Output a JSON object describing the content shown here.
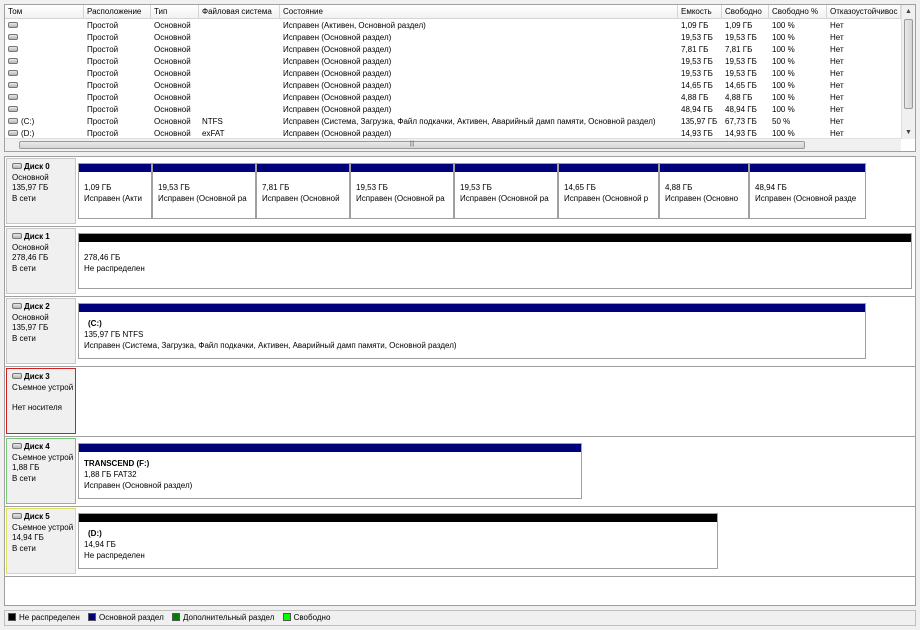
{
  "volume_list": {
    "columns": [
      "Том",
      "Расположение",
      "Тип",
      "Файловая система",
      "Состояние",
      "Емкость",
      "Свободно",
      "Свободно %",
      "Отказоустойчивос"
    ],
    "rows": [
      [
        "",
        "Простой",
        "Основной",
        "",
        "Исправен (Активен, Основной раздел)",
        "1,09 ГБ",
        "1,09 ГБ",
        "100 %",
        "Нет"
      ],
      [
        "",
        "Простой",
        "Основной",
        "",
        "Исправен (Основной раздел)",
        "19,53 ГБ",
        "19,53 ГБ",
        "100 %",
        "Нет"
      ],
      [
        "",
        "Простой",
        "Основной",
        "",
        "Исправен (Основной раздел)",
        "7,81 ГБ",
        "7,81 ГБ",
        "100 %",
        "Нет"
      ],
      [
        "",
        "Простой",
        "Основной",
        "",
        "Исправен (Основной раздел)",
        "19,53 ГБ",
        "19,53 ГБ",
        "100 %",
        "Нет"
      ],
      [
        "",
        "Простой",
        "Основной",
        "",
        "Исправен (Основной раздел)",
        "19,53 ГБ",
        "19,53 ГБ",
        "100 %",
        "Нет"
      ],
      [
        "",
        "Простой",
        "Основной",
        "",
        "Исправен (Основной раздел)",
        "14,65 ГБ",
        "14,65 ГБ",
        "100 %",
        "Нет"
      ],
      [
        "",
        "Простой",
        "Основной",
        "",
        "Исправен (Основной раздел)",
        "4,88 ГБ",
        "4,88 ГБ",
        "100 %",
        "Нет"
      ],
      [
        "",
        "Простой",
        "Основной",
        "",
        "Исправен (Основной раздел)",
        "48,94 ГБ",
        "48,94 ГБ",
        "100 %",
        "Нет"
      ],
      [
        "(C:)",
        "Простой",
        "Основной",
        "NTFS",
        "Исправен (Система, Загрузка, Файл подкачки, Активен, Аварийный дамп памяти, Основной раздел)",
        "135,97 ГБ",
        "67,73 ГБ",
        "50 %",
        "Нет"
      ],
      [
        "(D:)",
        "Простой",
        "Основной",
        "exFAT",
        "Исправен (Основной раздел)",
        "14,93 ГБ",
        "14,93 ГБ",
        "100 %",
        "Нет"
      ]
    ]
  },
  "disks": [
    {
      "name": "Диск 0",
      "type": "Основной",
      "size": "135,97 ГБ",
      "status": "В сети",
      "partitions": [
        {
          "size": "1,09 ГБ",
          "state": "Исправен (Акти"
        },
        {
          "size": "19,53 ГБ",
          "state": "Исправен (Основной ра"
        },
        {
          "size": "7,81 ГБ",
          "state": "Исправен (Основной"
        },
        {
          "size": "19,53 ГБ",
          "state": "Исправен (Основной ра"
        },
        {
          "size": "19,53 ГБ",
          "state": "Исправен (Основной ра"
        },
        {
          "size": "14,65 ГБ",
          "state": "Исправен (Основной р"
        },
        {
          "size": "4,88 ГБ",
          "state": "Исправен (Основно"
        },
        {
          "size": "48,94 ГБ",
          "state": "Исправен (Основной разде"
        }
      ]
    },
    {
      "name": "Диск 1",
      "type": "Основной",
      "size": "278,46 ГБ",
      "status": "В сети",
      "partitions": [
        {
          "size": "278,46 ГБ",
          "state": "Не распределен"
        }
      ]
    },
    {
      "name": "Диск 2",
      "type": "Основной",
      "size": "135,97 ГБ",
      "status": "В сети",
      "partitions": [
        {
          "label": "(C:)",
          "size": "135,97 ГБ NTFS",
          "state": "Исправен (Система, Загрузка, Файл подкачки, Активен, Аварийный дамп памяти, Основной раздел)"
        }
      ]
    },
    {
      "name": "Диск 3",
      "type": "Съемное устрой",
      "size": "",
      "status": "Нет носителя",
      "partitions": []
    },
    {
      "name": "Диск 4",
      "type": "Съемное устрой",
      "size": "1,88 ГБ",
      "status": "В сети",
      "partitions": [
        {
          "label": "TRANSCEND  (F:)",
          "size": "1,88 ГБ FAT32",
          "state": "Исправен (Основной раздел)"
        }
      ]
    },
    {
      "name": "Диск 5",
      "type": "Съемное устрой",
      "size": "14,94 ГБ",
      "status": "В сети",
      "partitions": [
        {
          "label": "(D:)",
          "size": "14,94 ГБ",
          "state": "Не распределен"
        }
      ]
    }
  ],
  "legend": {
    "items": [
      {
        "label": "Не распределен",
        "color": "#000000"
      },
      {
        "label": "Основной раздел",
        "color": "#00007b"
      },
      {
        "label": "Дополнительный раздел",
        "color": "#008000"
      },
      {
        "label": "Свободно",
        "color": "#00ff00"
      }
    ]
  },
  "icons": {
    "drive": "hard-drive-icon",
    "scroll_up": "▲",
    "scroll_down": "▼",
    "grip": "|||"
  }
}
